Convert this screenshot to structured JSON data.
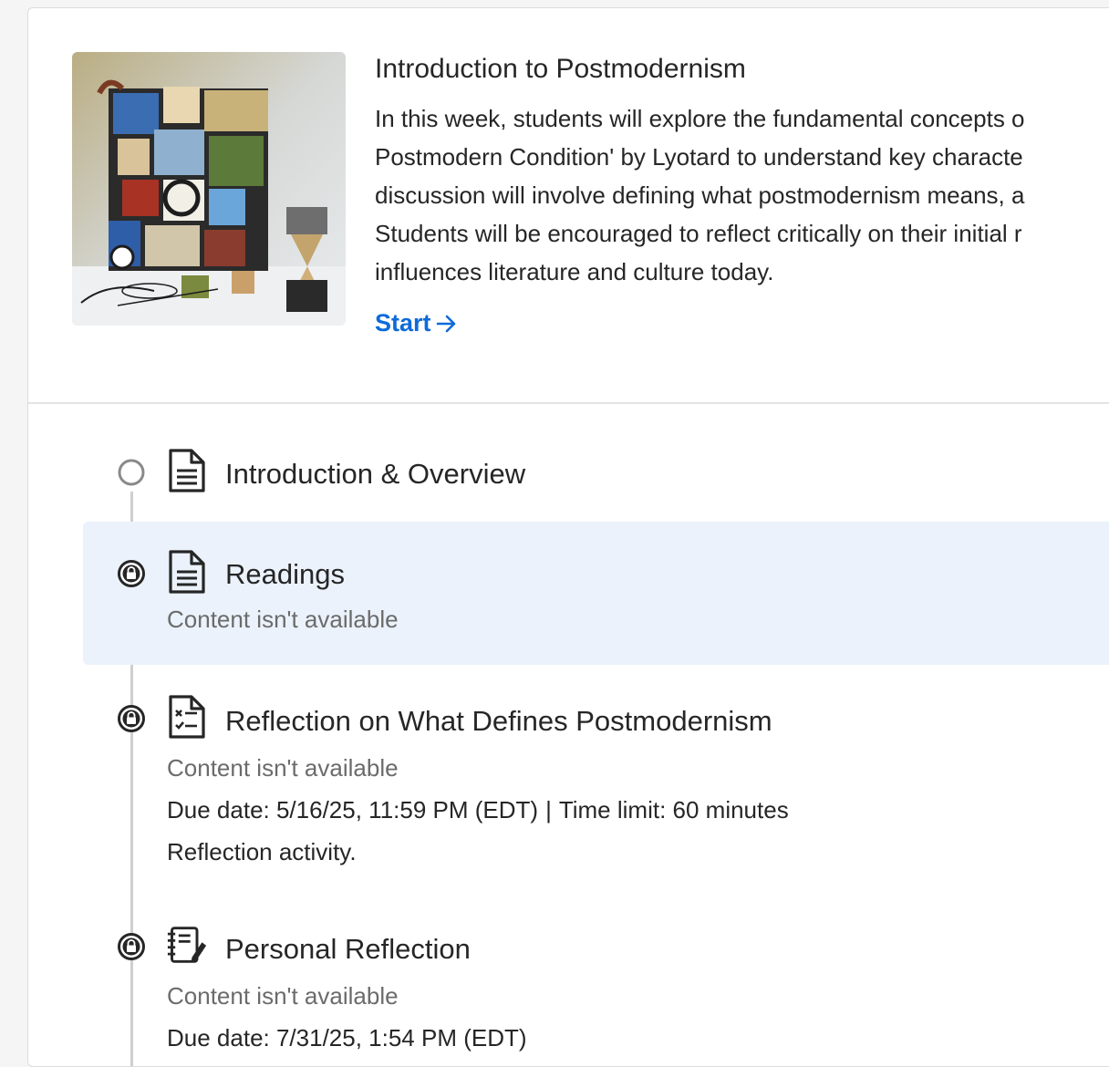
{
  "module": {
    "title": "Introduction to Postmodernism",
    "description_lines": [
      "In this week, students will explore the fundamental concepts o",
      "Postmodern Condition' by Lyotard to understand key characte",
      "discussion will involve defining what postmodernism means, a",
      "Students will be encouraged to reflect critically on their initial r",
      "influences literature and culture today."
    ],
    "start_label": "Start",
    "thumbnail_icon": "abstract-collage-image"
  },
  "items": [
    {
      "title": "Introduction & Overview",
      "status": "not-started",
      "icon": "document-icon"
    },
    {
      "title": "Readings",
      "status": "locked",
      "icon": "document-icon",
      "availability": "Content isn't available"
    },
    {
      "title": "Reflection on What Defines Postmodernism",
      "status": "locked",
      "icon": "assignment-icon",
      "availability": "Content isn't available",
      "due": "Due date: 5/16/25, 11:59 PM (EDT)",
      "separator": "|",
      "time_limit": "Time limit: 60 minutes",
      "description": "Reflection activity."
    },
    {
      "title": "Personal Reflection",
      "status": "locked",
      "icon": "journal-icon",
      "availability": "Content isn't available",
      "due": "Due date: 7/31/25, 1:54 PM (EDT)"
    }
  ],
  "colors": {
    "accent": "#0e6bd8",
    "highlight_bg": "#ebf2fb",
    "muted_text": "#6b6b6b",
    "timeline": "#cfcfcf"
  }
}
